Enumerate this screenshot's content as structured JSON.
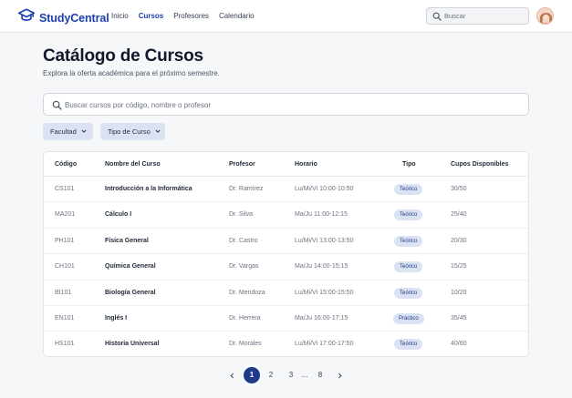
{
  "header": {
    "brand": "StudyCentral",
    "nav": [
      {
        "label": "Inicio",
        "active": false
      },
      {
        "label": "Cursos",
        "active": true
      },
      {
        "label": "Profesores",
        "active": false
      },
      {
        "label": "Calendario",
        "active": false
      }
    ],
    "search_placeholder": "Buscar"
  },
  "main": {
    "title": "Catálogo de Cursos",
    "subtitle": "Explora la oferta académica para el próximo semestre.",
    "search_placeholder": "Buscar cursos por código, nombre o profesor",
    "filters": [
      "Facultad",
      "Tipo de Curso"
    ]
  },
  "table": {
    "columns": [
      "Código",
      "Nombre del Curso",
      "Profesor",
      "Horario",
      "Tipo",
      "Cupos Disponibles"
    ],
    "rows": [
      {
        "code": "CS101",
        "name": "Introducción a la Informática",
        "professor": "Dr. Ramírez",
        "schedule": "Lu/Mi/Vi 10:00-10:50",
        "type": "Teórico",
        "seats": "30/50"
      },
      {
        "code": "MA201",
        "name": "Cálculo I",
        "professor": "Dr. Silva",
        "schedule": "Ma/Ju 11:00-12:15",
        "type": "Teórico",
        "seats": "25/40"
      },
      {
        "code": "PH101",
        "name": "Física General",
        "professor": "Dr. Castro",
        "schedule": "Lu/Mi/Vi 13:00-13:50",
        "type": "Teórico",
        "seats": "20/30"
      },
      {
        "code": "CH101",
        "name": "Química General",
        "professor": "Dr. Vargas",
        "schedule": "Ma/Ju 14:00-15:15",
        "type": "Teórico",
        "seats": "15/25"
      },
      {
        "code": "BI101",
        "name": "Biología General",
        "professor": "Dr. Mendoza",
        "schedule": "Lu/Mi/Vi 15:00-15:50",
        "type": "Teórico",
        "seats": "10/20"
      },
      {
        "code": "EN101",
        "name": "Inglés I",
        "professor": "Dr. Herrera",
        "schedule": "Ma/Ju 16:00-17:15",
        "type": "Práctico",
        "seats": "35/45"
      },
      {
        "code": "HS101",
        "name": "Historia Universal",
        "professor": "Dr. Morales",
        "schedule": "Lu/Mi/Vi 17:00-17:50",
        "type": "Teórico",
        "seats": "40/60"
      }
    ]
  },
  "pagination": {
    "pages": [
      "1",
      "2",
      "3",
      "8"
    ],
    "ellipsis": "...",
    "current": "1"
  },
  "colors": {
    "brand": "#1e40af",
    "accent": "#1e3a8a",
    "badge_bg": "#dbe3f3",
    "background": "#f6f7f9"
  },
  "icons": {
    "brand": "graduation-cap-icon",
    "search": "search-icon",
    "chevron": "chevron-down-icon",
    "prev": "chevron-left-icon",
    "next": "chevron-right-icon"
  }
}
